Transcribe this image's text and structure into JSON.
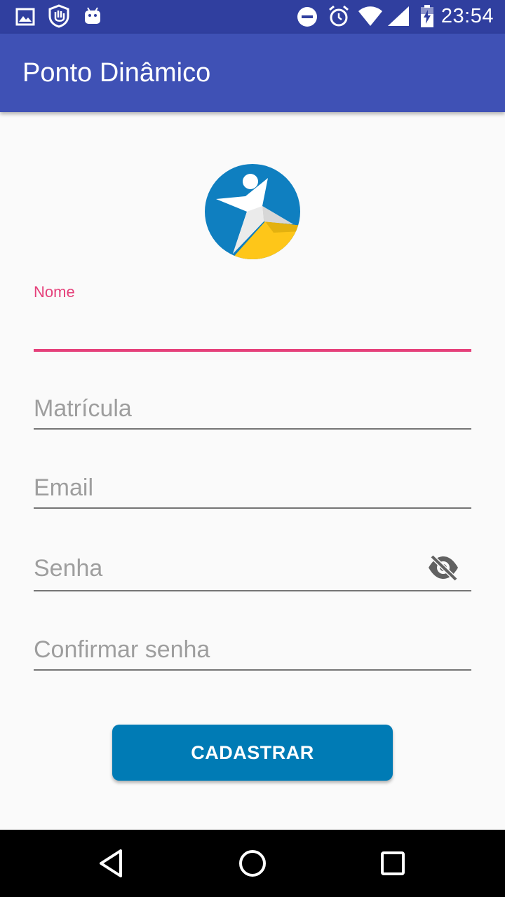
{
  "status_bar": {
    "time": "23:54",
    "left_icons": [
      "gallery-icon",
      "hand-shield-icon",
      "android-icon"
    ],
    "right_icons": [
      "do-not-disturb-icon",
      "alarm-icon",
      "wifi-icon",
      "signal-icon",
      "battery-charging-icon"
    ]
  },
  "app_bar": {
    "title": "Ponto Dinâmico"
  },
  "form": {
    "name_field": {
      "label": "Nome",
      "value": ""
    },
    "registration_field": {
      "placeholder": "Matrícula"
    },
    "email_field": {
      "placeholder": "Email"
    },
    "password_field": {
      "placeholder": "Senha",
      "toggle_icon": "visibility-off-icon"
    },
    "confirm_password_field": {
      "placeholder": "Confirmar senha"
    },
    "submit_label": "CADASTRAR"
  },
  "nav_bar": {
    "buttons": [
      "back-icon",
      "home-icon",
      "recents-icon"
    ]
  },
  "colors": {
    "status_bar": "#303f9f",
    "app_bar": "#3f51b5",
    "accent": "#e5407a",
    "button": "#007bb5",
    "logo_blue": "#0f7fc0",
    "logo_yellow": "#fec619"
  }
}
